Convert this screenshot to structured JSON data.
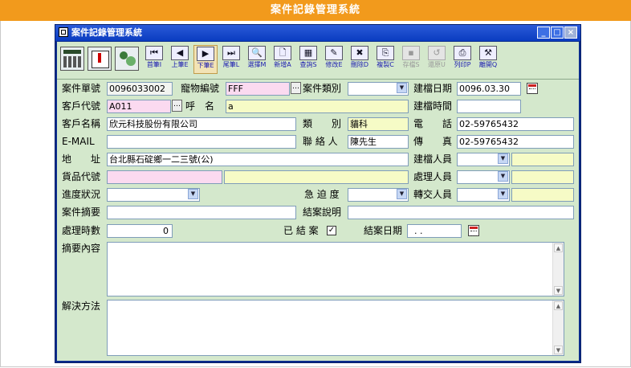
{
  "banner": {
    "title": "案件記錄管理系統"
  },
  "window": {
    "title": "案件記錄管理系統",
    "controls": {
      "minimize": "_",
      "maximize": "□",
      "close": "×"
    }
  },
  "toolbar": {
    "big_icons": [
      "calculator-icon",
      "calendar-alert-icon",
      "users-icon"
    ],
    "buttons": [
      {
        "icon": "first-record-icon",
        "glyph": "⏮",
        "label": "首筆I",
        "enabled": true
      },
      {
        "icon": "prev-record-icon",
        "glyph": "◀",
        "label": "上筆E",
        "enabled": true
      },
      {
        "icon": "next-record-icon",
        "glyph": "▶",
        "label": "下筆E",
        "enabled": true
      },
      {
        "icon": "last-record-icon",
        "glyph": "⏭",
        "label": "尾筆L",
        "enabled": true
      },
      {
        "icon": "find-icon",
        "glyph": "🔍",
        "label": "選擇M",
        "enabled": true
      },
      {
        "icon": "new-icon",
        "glyph": "🗋",
        "label": "新增A",
        "enabled": true
      },
      {
        "icon": "query-icon",
        "glyph": "▦",
        "label": "查詢S",
        "enabled": true
      },
      {
        "icon": "edit-icon",
        "glyph": "✎",
        "label": "修改E",
        "enabled": true
      },
      {
        "icon": "delete-icon",
        "glyph": "✖",
        "label": "刪除D",
        "enabled": true
      },
      {
        "icon": "copy-new-icon",
        "glyph": "⎘",
        "label": "複製C",
        "enabled": true
      },
      {
        "icon": "save-icon",
        "glyph": "▪",
        "label": "存檔S",
        "enabled": false
      },
      {
        "icon": "undo-icon",
        "glyph": "↺",
        "label": "還原U",
        "enabled": false
      },
      {
        "icon": "print-icon",
        "glyph": "⎙",
        "label": "列印P",
        "enabled": true
      },
      {
        "icon": "exit-icon",
        "glyph": "⚒",
        "label": "離開Q",
        "enabled": true
      }
    ]
  },
  "form": {
    "case_no": {
      "label": "案件單號",
      "value": "0096033002"
    },
    "pet_no": {
      "label": "寵物編號",
      "value": "FFF"
    },
    "case_type": {
      "label": "案件類別",
      "value": ""
    },
    "created_date": {
      "label": "建檔日期",
      "value": "0096.03.30"
    },
    "customer_code": {
      "label": "客戶代號",
      "value": "A011"
    },
    "nickname": {
      "label": "呼　名",
      "value": "a"
    },
    "created_time": {
      "label": "建檔時間",
      "value": ""
    },
    "customer_name": {
      "label": "客戶名稱",
      "value": "欣元科技股份有限公司"
    },
    "category": {
      "label": "類　　別",
      "value": "貓科"
    },
    "phone": {
      "label": "電　　話",
      "value": "02-59765432"
    },
    "email": {
      "label": "E-MAIL",
      "value": ""
    },
    "contact": {
      "label": "聯 絡 人",
      "value": "陳先生"
    },
    "fax": {
      "label": "傳　　真",
      "value": "02-59765432"
    },
    "address": {
      "label": "地　　址",
      "value": "台北縣石碇鄉一二三號(公)"
    },
    "creator": {
      "label": "建檔人員",
      "value": ""
    },
    "goods_code": {
      "label": "貨品代號",
      "value": ""
    },
    "handler": {
      "label": "處理人員",
      "value": ""
    },
    "progress": {
      "label": "進度狀況",
      "value": ""
    },
    "urgency": {
      "label": "急 迫 度",
      "value": ""
    },
    "transfer": {
      "label": "轉交人員",
      "value": ""
    },
    "summary": {
      "label": "案件摘要",
      "value": ""
    },
    "close_note": {
      "label": "結案說明",
      "value": ""
    },
    "hours": {
      "label": "處理時數",
      "value": "0"
    },
    "closed": {
      "label": "已 結 案",
      "checked": true,
      "mark": "✓"
    },
    "close_date": {
      "label": "結案日期",
      "value": " . ."
    },
    "summary_content": {
      "label": "摘要內容",
      "value": ""
    },
    "solution": {
      "label": "解決方法",
      "value": ""
    }
  }
}
